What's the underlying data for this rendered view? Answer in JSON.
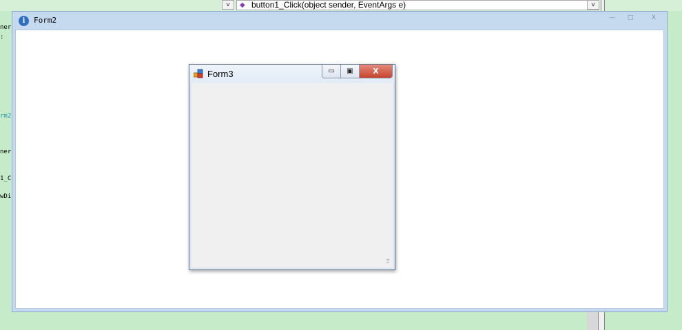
{
  "ide": {
    "method_signature": "button1_Click(object sender, EventArgs e)",
    "dropdown_glyph": "v",
    "code_fragments": [
      "ner",
      ":",
      "rm2",
      "ner",
      "1_C",
      "wDi"
    ]
  },
  "form2": {
    "title": "Form2",
    "icon_glyph": "i",
    "minimize_glyph": "—",
    "maximize_glyph": "□",
    "close_glyph": "X"
  },
  "form3": {
    "title": "Form3",
    "minimize_glyph": "▭",
    "maximize_glyph": "▣",
    "close_glyph": "X",
    "grip_glyph": "⠿"
  }
}
